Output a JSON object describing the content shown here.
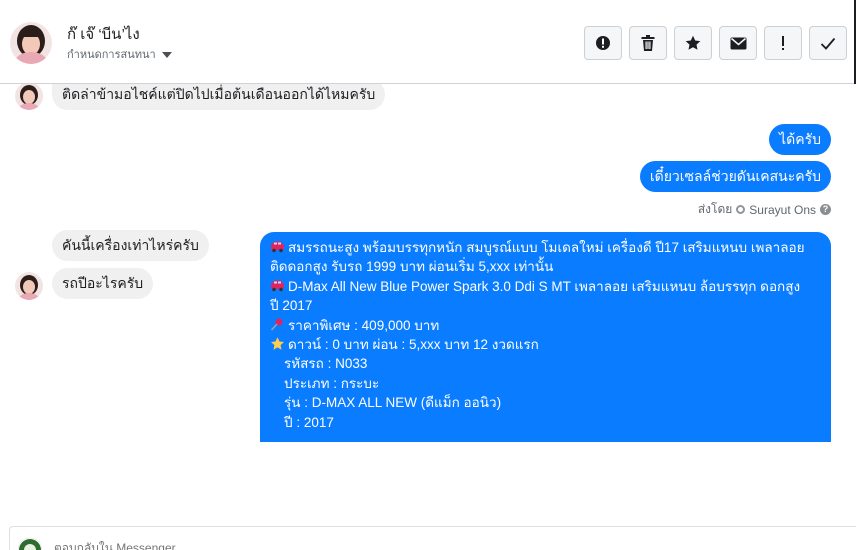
{
  "header": {
    "contact_name": "ก๊ เจ๊ ‘บีน’ไง",
    "conversation_menu_label": "กำหนดการสนทนา"
  },
  "actions": [
    {
      "name": "report-button",
      "icon": "exclamation-circle-icon"
    },
    {
      "name": "delete-button",
      "icon": "trash-icon"
    },
    {
      "name": "star-button",
      "icon": "star-icon"
    },
    {
      "name": "mark-unread-button",
      "icon": "envelope-icon"
    },
    {
      "name": "follow-up-button",
      "icon": "exclamation-icon"
    },
    {
      "name": "done-button",
      "icon": "check-icon"
    }
  ],
  "messages": {
    "incoming_1": "ติดล่าข้ามอไชค์แต่ปิดไปเมื่อต้นเดือนออกได้ไหมครับ",
    "outgoing_1": "ได้ครับ",
    "outgoing_2": "เดี๋ยวเซลล์ช่วยดันเคสนะครับ",
    "sent_by_label": "ส่งโดย",
    "sent_by_name": "Surayut Ons",
    "incoming_2": "คันนี้เครื่องเท่าไหร่ครับ",
    "incoming_3": "รถปีอะไรครับ",
    "long_message": {
      "line_1": "สมรรถนะสูง พร้อมบรรทุกหนัก สมบูรณ์แบบ โมเดลใหม่ เครื่องดี ปี17 เสริมแหนบ เพลาลอย",
      "line_2": "ติดดอกสูง รับรถ 1999 บาท ผ่อนเริ่ม 5,xxx เท่านั้น",
      "line_3": "D-Max All New Blue Power Spark 3.0 Ddi S MT เพลาลอย เสริมแหนบ ล้อบรรทุก ดอกสูง",
      "line_4": "ปี 2017",
      "line_5": "ราคาพิเศษ : 409,000 บาท",
      "line_6": "ดาวน์ : 0 บาท ผ่อน : 5,xxx บาท 12 งวดแรก",
      "line_7": "รหัสรถ : N033",
      "line_8": "ประเภท : กระบะ",
      "line_9": "รุ่น : D-MAX ALL NEW (ดีแม็ก ออนิว)",
      "line_10": "ปี : 2017"
    }
  },
  "composer": {
    "placeholder": "ตอบกลับใน Messenger"
  },
  "colors": {
    "outgoing_bubble": "#0a7cff",
    "incoming_bubble": "#f1f0f0",
    "button_bg": "#f5f6f7"
  }
}
